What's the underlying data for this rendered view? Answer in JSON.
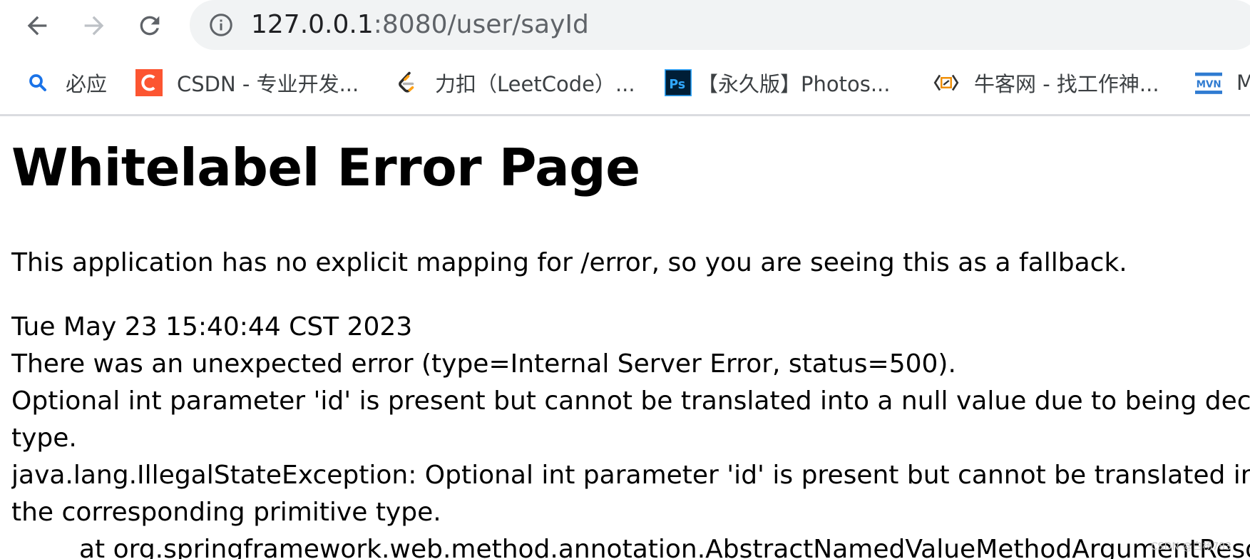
{
  "browser": {
    "url_host": "127.0.0.1",
    "url_path": ":8080/user/sayId"
  },
  "bookmarks": [
    {
      "label": "必应",
      "icon": "bing-search-icon"
    },
    {
      "label": "CSDN - 专业开发...",
      "icon": "csdn-icon"
    },
    {
      "label": "力扣（LeetCode）...",
      "icon": "leetcode-icon"
    },
    {
      "label": "【永久版】Photos...",
      "icon": "photoshop-icon"
    },
    {
      "label": "牛客网 - 找工作神...",
      "icon": "nowcoder-icon"
    },
    {
      "label": "M",
      "icon": "mvn-icon"
    }
  ],
  "page": {
    "title": "Whitelabel Error Page",
    "fallback": "This application has no explicit mapping for /error, so you are seeing this as a fallback.",
    "timestamp": "Tue May 23 15:40:44 CST 2023",
    "error_type": "There was an unexpected error (type=Internal Server Error, status=500).",
    "message_line1": "Optional int parameter 'id' is present but cannot be translated into a null value due to being declared as a primitive",
    "message_line2": "type.",
    "exception_line1": "java.lang.IllegalStateException: Optional int parameter 'id' is present but cannot be translated into a null value due to being declared as",
    "exception_line2": "the corresponding primitive type.",
    "stack_line": "at org.springframework.web.method.annotation.AbstractNamedValueMethodArgumentResolver"
  },
  "watermark": "CSDN @白杨783",
  "colors": {
    "omnibox_bg": "#f1f3f4",
    "csdn_red": "#fc5531",
    "photoshop_bg": "#001e36",
    "photoshop_text": "#31a8ff",
    "bing_blue": "#1a73e8",
    "mvn_blue": "#2f7bd1"
  }
}
